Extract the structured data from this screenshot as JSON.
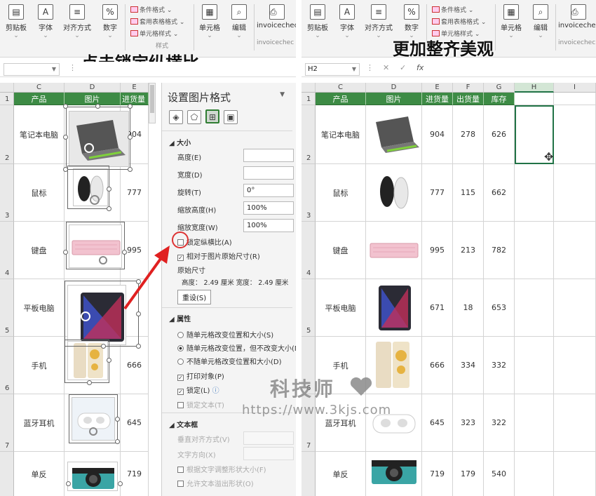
{
  "ribbon": {
    "clipboard": "剪贴板",
    "font": "字体",
    "alignment": "对齐方式",
    "number": "数字",
    "conditional_format": "条件格式",
    "table_format": "套用表格格式",
    "cell_style": "单元格样式",
    "style_group": "样式",
    "cells": "单元格",
    "editing": "编辑",
    "addin": "invoicechec",
    "addin_sub": "invoicechec"
  },
  "left": {
    "caption": "点击锁定纵横比",
    "namebox": ""
  },
  "right": {
    "caption": "更加整齐美观",
    "namebox": "H2"
  },
  "columns_left": [
    "C",
    "D",
    "E"
  ],
  "columns_right": [
    "C",
    "D",
    "E",
    "F",
    "G",
    "H",
    "I"
  ],
  "headers": {
    "product": "产品",
    "image": "图片",
    "purchase": "进货量",
    "shipment": "出货量",
    "stock": "库存",
    "purchase_trunc": "进货量"
  },
  "rows": [
    {
      "num": "2",
      "product": "笔记本电脑",
      "purchase": "904",
      "shipment": "278",
      "stock": "626",
      "purchase_left": "904"
    },
    {
      "num": "3",
      "product": "鼠标",
      "purchase": "777",
      "shipment": "115",
      "stock": "662",
      "purchase_left": "777"
    },
    {
      "num": "4",
      "product": "键盘",
      "purchase": "995",
      "shipment": "213",
      "stock": "782",
      "purchase_left": "995"
    },
    {
      "num": "5",
      "product": "平板电脑",
      "purchase": "671",
      "shipment": "18",
      "stock": "653",
      "purchase_left": ""
    },
    {
      "num": "6",
      "product": "手机",
      "purchase": "666",
      "shipment": "334",
      "stock": "332",
      "purchase_left": "666"
    },
    {
      "num": "7",
      "product": "蓝牙耳机",
      "purchase": "645",
      "shipment": "323",
      "stock": "322",
      "purchase_left": "645"
    },
    {
      "num": "",
      "product": "单反",
      "purchase": "719",
      "shipment": "179",
      "stock": "540",
      "purchase_left": "719"
    }
  ],
  "header_row_num": "1",
  "format_pane": {
    "title": "设置图片格式",
    "size_section": "大小",
    "height_label": "高度(E)",
    "width_label": "宽度(D)",
    "rotation_label": "旋转(T)",
    "rotation_value": "0°",
    "scale_height_label": "缩放高度(H)",
    "scale_height_value": "100%",
    "scale_width_label": "缩放宽度(W)",
    "scale_width_value": "100%",
    "lock_aspect": "锁定纵横比(A)",
    "relative_original": "相对于图片原始尺寸(R)",
    "original_size": "原始尺寸",
    "original_dims": "高度：  2.49 厘米    宽度：  2.49 厘米",
    "reset": "重设(S)",
    "properties_section": "属性",
    "prop1": "随单元格改变位置和大小(S)",
    "prop2": "随单元格改变位置，但不改变大小(M)",
    "prop3": "不随单元格改变位置和大小(D)",
    "print_object": "打印对象(P)",
    "locked": "锁定(L)",
    "lock_text": "锁定文本(T)",
    "textbox_section": "文本框",
    "valign": "垂直对齐方式(V)",
    "text_dir": "文字方向(X)",
    "autofit": "根据文字调整形状大小(F)",
    "overflow": "允许文本溢出形状(O)"
  },
  "watermark": {
    "name": "科技师",
    "url": "https://www.3kjs.com"
  },
  "colors": {
    "header_green": "#3d8b45",
    "arrow_red": "#e02020",
    "selection_green": "#217346"
  }
}
